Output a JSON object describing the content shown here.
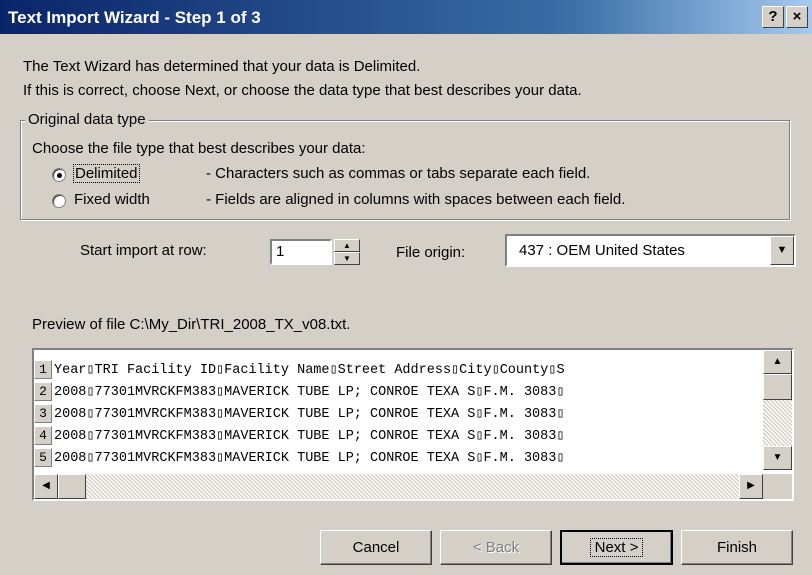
{
  "window": {
    "title": "Text Import Wizard - Step 1 of 3",
    "help_glyph": "?",
    "close_glyph": "×"
  },
  "intro": {
    "line1": "The Text Wizard has determined that your data is Delimited.",
    "line2": "If this is correct, choose Next, or choose the data type that best describes your data."
  },
  "data_type": {
    "legend": "Original data type",
    "prompt": "Choose the file type that best describes your data:",
    "options": [
      {
        "label": "Delimited",
        "description": "- Characters such as commas or tabs separate each field.",
        "checked": true
      },
      {
        "label": "Fixed width",
        "description": "- Fields are aligned in columns with spaces between each field.",
        "checked": false
      }
    ]
  },
  "start_row": {
    "label": "Start import at row:",
    "value": "1"
  },
  "file_origin": {
    "label": "File origin:",
    "value": "437 : OEM United States"
  },
  "preview": {
    "label": "Preview of file C:\\My_Dir\\TRI_2008_TX_v08.txt.",
    "rows": [
      {
        "num": "1",
        "text": "Year▯TRI Facility ID▯Facility Name▯Street Address▯City▯County▯S"
      },
      {
        "num": "2",
        "text": "2008▯77301MVRCKFM383▯MAVERICK TUBE LP; CONROE TEXA S▯F.M. 3083▯"
      },
      {
        "num": "3",
        "text": "2008▯77301MVRCKFM383▯MAVERICK TUBE LP; CONROE TEXA S▯F.M. 3083▯"
      },
      {
        "num": "4",
        "text": "2008▯77301MVRCKFM383▯MAVERICK TUBE LP; CONROE TEXA S▯F.M. 3083▯"
      },
      {
        "num": "5",
        "text": "2008▯77301MVRCKFM383▯MAVERICK TUBE LP; CONROE TEXA S▯F.M. 3083▯"
      }
    ]
  },
  "buttons": {
    "cancel": "Cancel",
    "back": "< Back",
    "next": "Next >",
    "finish": "Finish"
  }
}
